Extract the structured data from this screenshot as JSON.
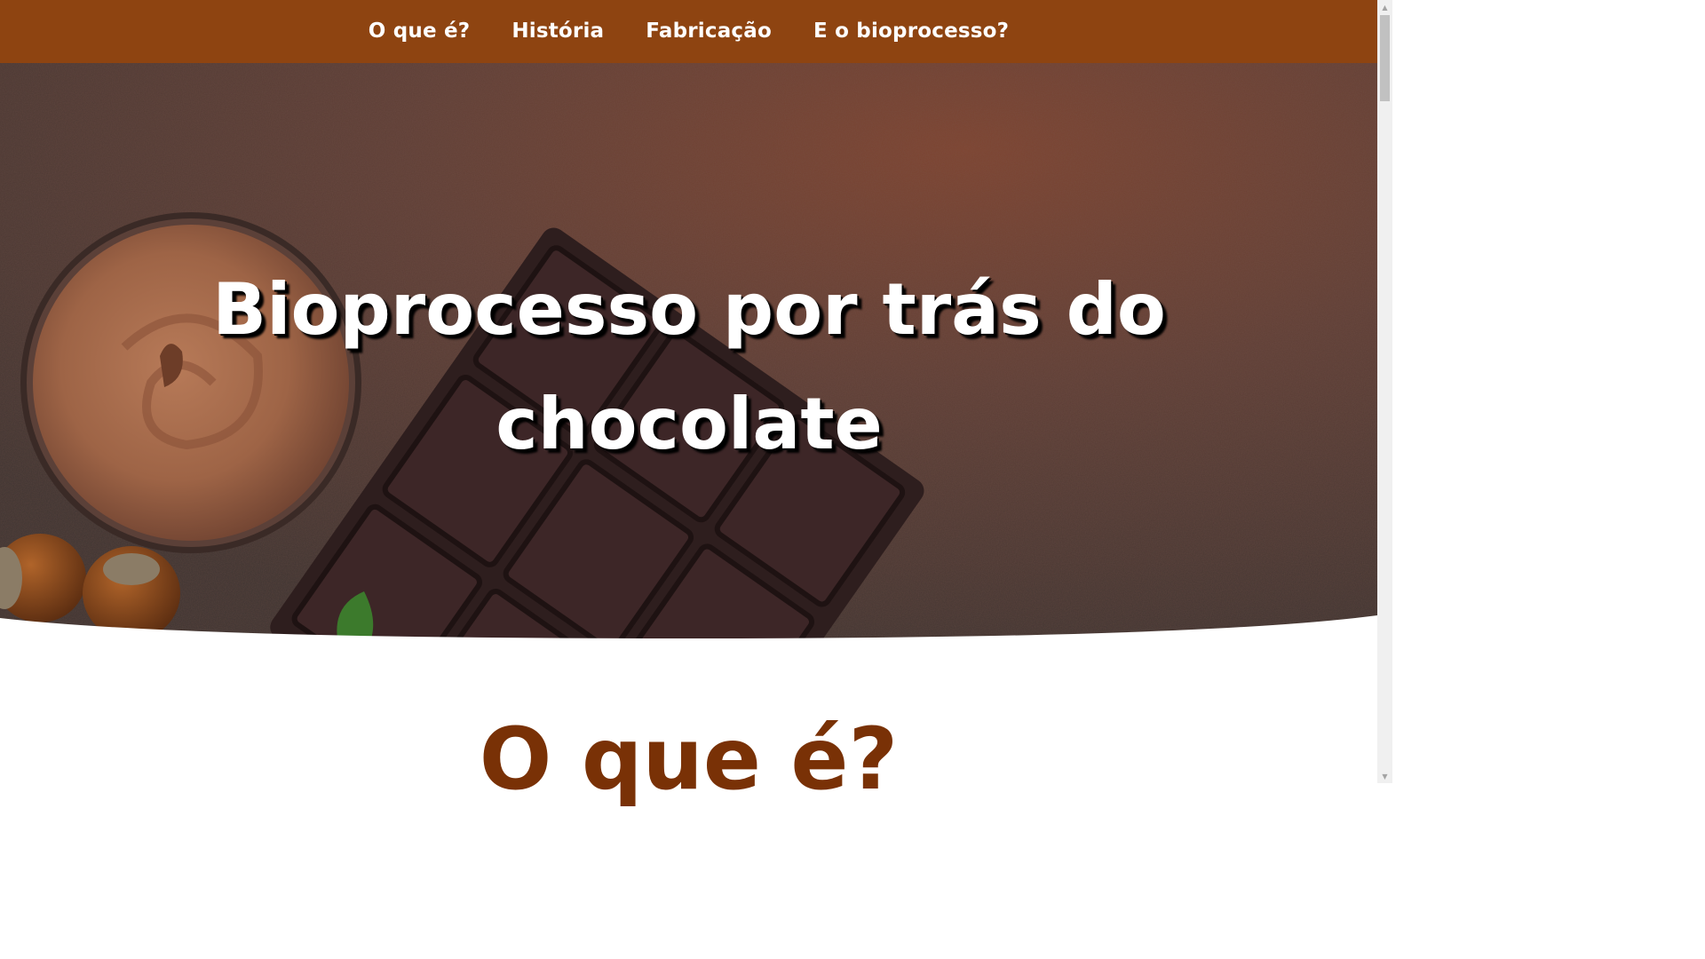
{
  "nav": {
    "items": [
      {
        "label": "O que é?"
      },
      {
        "label": "História"
      },
      {
        "label": "Fabricação"
      },
      {
        "label": "E o bioprocesso?"
      }
    ]
  },
  "hero": {
    "title_line1": "Bioprocesso por trás do",
    "title_line2": "chocolate",
    "image": "chocolate-bar-with-hazelnut-spread-photo"
  },
  "section": {
    "title": "O que é?"
  },
  "colors": {
    "navbar": "#8e4411",
    "section_title": "#793106",
    "hero_text": "#ffffff"
  }
}
